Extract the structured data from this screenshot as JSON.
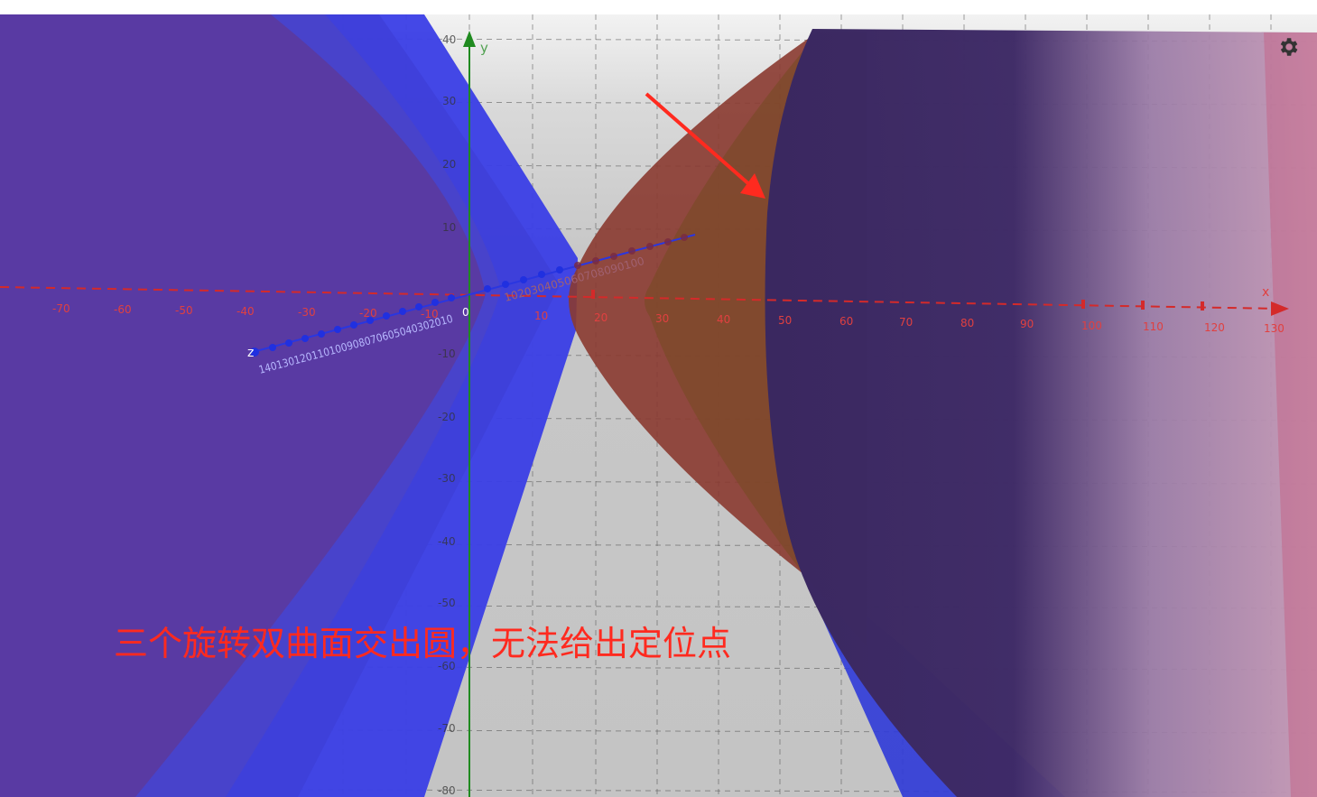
{
  "axes": {
    "x_label": "x",
    "y_label": "y",
    "z_label": "z",
    "x_ticks": [
      "-70",
      "-60",
      "-50",
      "-40",
      "-30",
      "-20",
      "-10",
      "10",
      "20",
      "30",
      "40",
      "50",
      "60",
      "70",
      "80",
      "90",
      "100",
      "110",
      "120",
      "130"
    ],
    "y_ticks": [
      "40",
      "30",
      "20",
      "10",
      "-10",
      "-20",
      "-30",
      "-40",
      "-50",
      "-60",
      "-70",
      "-80"
    ],
    "z_ticks_near": "140130120110100908070605040302010",
    "z_ticks_far": "102030405060708090100",
    "origin_label": "0"
  },
  "colors": {
    "axis_x": "#d42a2a",
    "axis_y": "#1f8a1f",
    "axis_z": "#2a36e0",
    "surface_blue": "#3b3fe0",
    "surface_purple": "#5b3aa0",
    "surface_brown": "#8a3a30",
    "surface_dark": "#3a2860",
    "annotation": "#ff2a1f"
  },
  "annotation": {
    "text": "三个旋转双曲面交出圆，无法给出定位点"
  },
  "toolbar": {
    "settings_icon": "gear-icon"
  }
}
